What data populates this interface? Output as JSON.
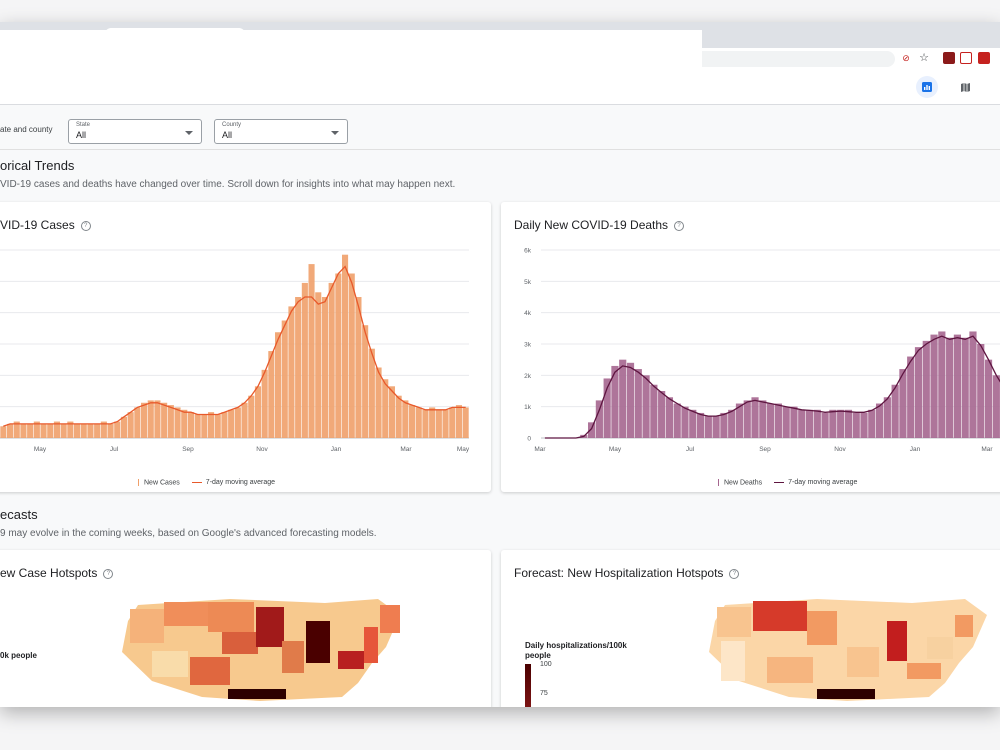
{
  "filters": {
    "label": "ate and county",
    "state": {
      "caption": "State",
      "value": "All"
    },
    "county": {
      "caption": "County",
      "value": "All"
    }
  },
  "historical": {
    "title": "orical Trends",
    "subtitle": "VID-19 cases and deaths have changed over time. Scroll down for insights into what may happen next."
  },
  "cases_card": {
    "title": "VID-19 Cases",
    "legend": {
      "bars": "New Cases",
      "line": "7-day moving average"
    }
  },
  "deaths_card": {
    "title": "Daily New COVID-19 Deaths",
    "legend": {
      "bars": "New Deaths",
      "line": "7-day moving average"
    }
  },
  "forecasts": {
    "title": "ecasts",
    "subtitle": "9 may evolve in the coming weeks, based on Google's advanced forecasting models."
  },
  "hotspot_card_1": {
    "title": "ew Case Hotspots",
    "legend_fragment": "0k people"
  },
  "hotspot_card_2": {
    "title": "Forecast: New Hospitalization Hotspots",
    "legend_title": "Daily hospitalizations/100k people",
    "legend_ticks": [
      "100",
      "75"
    ]
  },
  "colors": {
    "cases": "#f0a06a",
    "cases_line": "#e8592b",
    "deaths": "#a5668f",
    "deaths_line": "#5e1540",
    "accent": "#1a73e8"
  },
  "chart_data": [
    {
      "type": "bar",
      "title": "COVID-19 Cases",
      "x_tick_labels": [
        "May",
        "Jul",
        "Sep",
        "Nov",
        "Jan",
        "Mar",
        "May"
      ],
      "series": [
        {
          "name": "New Cases",
          "kind": "bar",
          "values": [
            0.05,
            0.06,
            0.07,
            0.06,
            0.06,
            0.07,
            0.06,
            0.06,
            0.07,
            0.06,
            0.07,
            0.06,
            0.06,
            0.06,
            0.06,
            0.07,
            0.06,
            0.07,
            0.09,
            0.11,
            0.13,
            0.15,
            0.16,
            0.16,
            0.15,
            0.14,
            0.13,
            0.12,
            0.11,
            0.1,
            0.1,
            0.11,
            0.1,
            0.11,
            0.12,
            0.13,
            0.15,
            0.18,
            0.22,
            0.29,
            0.37,
            0.45,
            0.5,
            0.56,
            0.6,
            0.66,
            0.74,
            0.62,
            0.6,
            0.66,
            0.7,
            0.78,
            0.7,
            0.6,
            0.48,
            0.38,
            0.3,
            0.25,
            0.22,
            0.18,
            0.16,
            0.14,
            0.13,
            0.12,
            0.13,
            0.12,
            0.12,
            0.13,
            0.14,
            0.13
          ]
        },
        {
          "name": "7-day moving average",
          "kind": "line",
          "values": [
            0.05,
            0.06,
            0.06,
            0.06,
            0.06,
            0.06,
            0.06,
            0.06,
            0.06,
            0.06,
            0.06,
            0.06,
            0.06,
            0.06,
            0.06,
            0.06,
            0.06,
            0.07,
            0.09,
            0.11,
            0.13,
            0.14,
            0.15,
            0.15,
            0.14,
            0.13,
            0.12,
            0.11,
            0.11,
            0.1,
            0.1,
            0.1,
            0.1,
            0.11,
            0.12,
            0.13,
            0.15,
            0.18,
            0.22,
            0.28,
            0.35,
            0.42,
            0.48,
            0.54,
            0.58,
            0.6,
            0.6,
            0.57,
            0.58,
            0.64,
            0.7,
            0.73,
            0.66,
            0.56,
            0.45,
            0.36,
            0.28,
            0.23,
            0.2,
            0.17,
            0.15,
            0.14,
            0.13,
            0.12,
            0.12,
            0.12,
            0.12,
            0.13,
            0.13,
            0.13
          ]
        }
      ]
    },
    {
      "type": "bar",
      "title": "Daily New COVID-19 Deaths",
      "y_tick_labels": [
        "0",
        "1k",
        "2k",
        "3k",
        "4k",
        "5k",
        "6k"
      ],
      "x_tick_labels": [
        "Mar",
        "May",
        "Jul",
        "Sep",
        "Nov",
        "Jan",
        "Mar"
      ],
      "ylim": [
        0,
        6000
      ],
      "series": [
        {
          "name": "New Deaths",
          "kind": "bar",
          "values": [
            0,
            0,
            0,
            0,
            0,
            100,
            500,
            1200,
            1900,
            2300,
            2500,
            2400,
            2200,
            2000,
            1700,
            1500,
            1300,
            1100,
            1000,
            900,
            800,
            700,
            700,
            800,
            900,
            1100,
            1200,
            1300,
            1200,
            1100,
            1100,
            1000,
            1000,
            900,
            900,
            900,
            800,
            900,
            900,
            900,
            800,
            800,
            900,
            1100,
            1300,
            1700,
            2200,
            2600,
            2900,
            3100,
            3300,
            3400,
            3200,
            3300,
            3200,
            3400,
            3000,
            2500,
            2000,
            1500
          ]
        },
        {
          "name": "7-day moving average",
          "kind": "line",
          "values": [
            0,
            0,
            0,
            0,
            0,
            50,
            300,
            900,
            1600,
            2100,
            2300,
            2250,
            2100,
            1900,
            1650,
            1450,
            1250,
            1100,
            950,
            850,
            750,
            700,
            700,
            750,
            850,
            1000,
            1150,
            1200,
            1150,
            1100,
            1050,
            1000,
            950,
            900,
            880,
            860,
            820,
            840,
            860,
            840,
            820,
            820,
            880,
            1020,
            1250,
            1600,
            2050,
            2450,
            2800,
            3000,
            3150,
            3250,
            3150,
            3200,
            3150,
            3250,
            2950,
            2500,
            2000,
            1600
          ]
        }
      ]
    }
  ]
}
